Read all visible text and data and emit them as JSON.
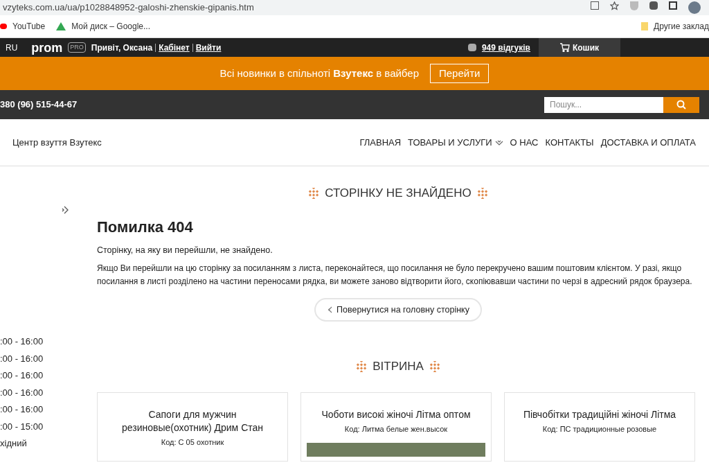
{
  "browser": {
    "url": "vzyteks.com.ua/ua/p1028848952-galoshi-zhenskie-gipanis.htm",
    "bookmarks": [
      {
        "label": "YouTube",
        "kind": "youtube"
      },
      {
        "label": "Мой диск – Google...",
        "kind": "drive"
      }
    ],
    "other_bookmarks": "Другие заклад"
  },
  "topbar": {
    "lang": "RU",
    "logo": "prom",
    "badge": "PRO",
    "greeting": "Привіт, Оксана",
    "links": [
      "Кабінет",
      "Вийти"
    ],
    "reviews": "949 відгуків",
    "cart": "Кошик"
  },
  "banner": {
    "text": "Всі новинки в спільноті **Взутекс** в вайбер",
    "button": "Перейти"
  },
  "contactbar": {
    "phone": "380 (96) 515-44-67",
    "search_placeholder": "Пошук..."
  },
  "header": {
    "shop_name": "Центр взуття Взутекс",
    "nav": [
      {
        "label": "ГЛАВНАЯ",
        "dropdown": false
      },
      {
        "label": "ТОВАРЫ И УСЛУГИ",
        "dropdown": true
      },
      {
        "label": "О НАС",
        "dropdown": false
      },
      {
        "label": "КОНТАКТЫ",
        "dropdown": false
      },
      {
        "label": "ДОСТАВКА И ОПЛАТА",
        "dropdown": false
      }
    ]
  },
  "sidebar": {
    "hours": [
      ":00 - 16:00",
      ":00 - 16:00",
      ":00 - 16:00",
      ":00 - 16:00",
      ":00 - 16:00",
      ":00 - 15:00",
      "хідний"
    ]
  },
  "error": {
    "heading": "СТОРІНКУ НЕ ЗНАЙДЕНО",
    "title": "Помилка 404",
    "subtitle": "Сторінку, на яку ви перейшли, не знайдено.",
    "body": "Якщо Ви перейшли на цю сторінку за посиланням з листа, переконайтеся, що посилання не було перекручено вашим поштовим клієнтом. У разі, якщо посилання в листі розділено на частини переносами рядка, ви можете заново відтворити його, скопіювавши частини по черзі в адресний рядок браузера.",
    "back_button": "Повернутися на головну сторінку"
  },
  "showcase": {
    "heading": "ВІТРИНА",
    "products": [
      {
        "name": "Сапоги для мужчин резиновые(охотник) Дрим Стан",
        "code": "Код: С 05 охотник",
        "photo": false
      },
      {
        "name": "Чоботи високі жіночі Літма оптом",
        "code": "Код: Литма белые жен.высок",
        "photo": true
      },
      {
        "name": "Півчобітки традиційні жіночі Літма",
        "code": "Код: ПС традиционные розовые",
        "photo": false
      }
    ]
  }
}
